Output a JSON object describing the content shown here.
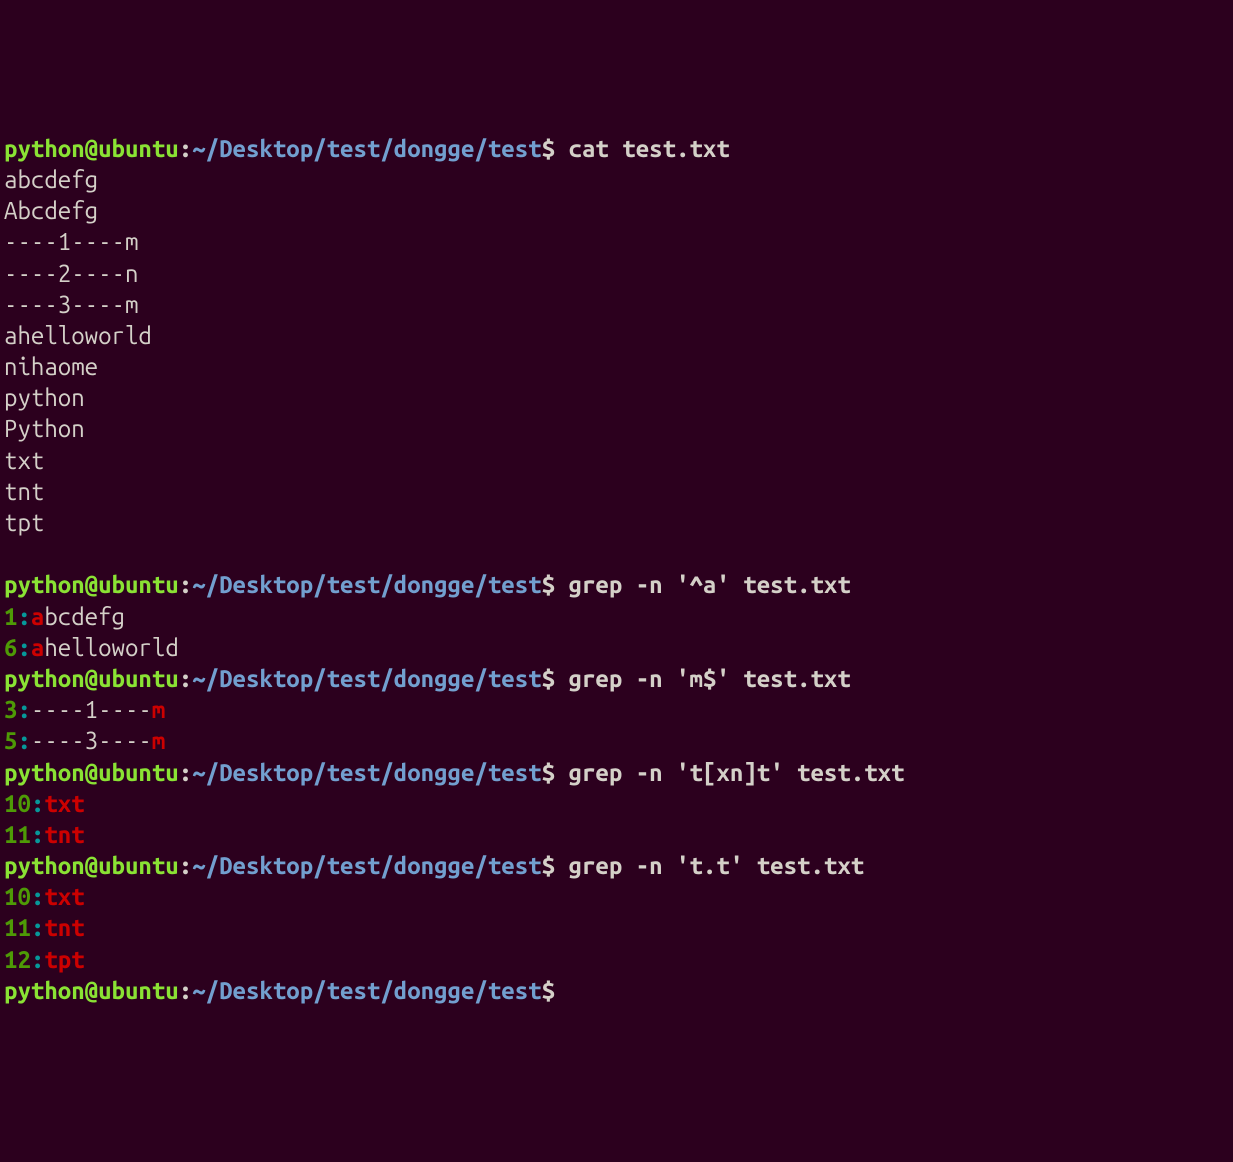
{
  "prompt": {
    "user": "python@ubuntu",
    "colon": ":",
    "path": "~/Desktop/test/dongge/test",
    "dollar": "$"
  },
  "session": [
    {
      "type": "command",
      "cmd": " cat test.txt"
    },
    {
      "type": "output",
      "text": "abcdefg"
    },
    {
      "type": "output",
      "text": "Abcdefg"
    },
    {
      "type": "output",
      "text": "----1----m"
    },
    {
      "type": "output",
      "text": "----2----n"
    },
    {
      "type": "output",
      "text": "----3----m"
    },
    {
      "type": "output",
      "text": "ahelloworld"
    },
    {
      "type": "output",
      "text": "nihaome"
    },
    {
      "type": "output",
      "text": "python"
    },
    {
      "type": "output",
      "text": "Python"
    },
    {
      "type": "output",
      "text": "txt"
    },
    {
      "type": "output",
      "text": "tnt"
    },
    {
      "type": "output",
      "text": "tpt"
    },
    {
      "type": "blank"
    },
    {
      "type": "command",
      "cmd": " grep -n '^a' test.txt"
    },
    {
      "type": "grep",
      "linenum": "1",
      "sep": ":",
      "match": "a",
      "rest": "bcdefg"
    },
    {
      "type": "grep",
      "linenum": "6",
      "sep": ":",
      "match": "a",
      "rest": "helloworld"
    },
    {
      "type": "command",
      "cmd": " grep -n 'm$' test.txt"
    },
    {
      "type": "grep",
      "linenum": "3",
      "sep": ":",
      "pre": "----1----",
      "match": "m",
      "rest": ""
    },
    {
      "type": "grep",
      "linenum": "5",
      "sep": ":",
      "pre": "----3----",
      "match": "m",
      "rest": ""
    },
    {
      "type": "command",
      "cmd": " grep -n 't[xn]t' test.txt"
    },
    {
      "type": "grep",
      "linenum": "10",
      "sep": ":",
      "match": "txt",
      "rest": ""
    },
    {
      "type": "grep",
      "linenum": "11",
      "sep": ":",
      "match": "tnt",
      "rest": ""
    },
    {
      "type": "command",
      "cmd": " grep -n 't.t' test.txt"
    },
    {
      "type": "grep",
      "linenum": "10",
      "sep": ":",
      "match": "txt",
      "rest": ""
    },
    {
      "type": "grep",
      "linenum": "11",
      "sep": ":",
      "match": "tnt",
      "rest": ""
    },
    {
      "type": "grep",
      "linenum": "12",
      "sep": ":",
      "match": "tpt",
      "rest": ""
    },
    {
      "type": "command",
      "cmd": ""
    }
  ]
}
